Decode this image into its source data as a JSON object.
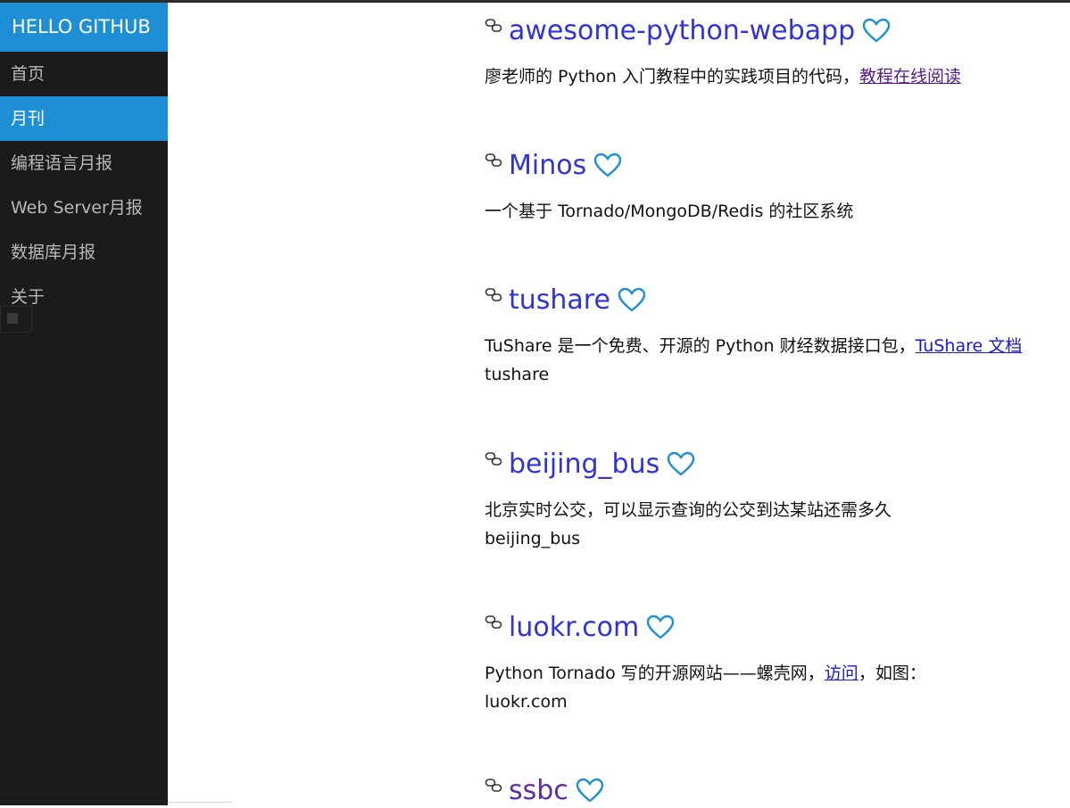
{
  "sidebar": {
    "brand": "HELLO GITHUB",
    "items": [
      {
        "label": "首页",
        "active": false
      },
      {
        "label": "月刊",
        "active": true
      },
      {
        "label": "编程语言月报",
        "active": false
      },
      {
        "label": "Web Server月报",
        "active": false
      },
      {
        "label": "数据库月报",
        "active": false
      },
      {
        "label": "关于",
        "active": false
      }
    ]
  },
  "projects": [
    {
      "name": "awesome-python-webapp",
      "desc": "廖老师的 Python 入门教程中的实践项目的代码，",
      "link": "教程在线阅读",
      "extra": ""
    },
    {
      "name": "Minos",
      "desc": "一个基于 Tornado/MongoDB/Redis 的社区系统",
      "link": "",
      "extra": ""
    },
    {
      "name": "tushare",
      "desc": "TuShare 是一个免费、开源的 Python 财经数据接口包，",
      "link": "TuShare 文档",
      "extra": "tushare"
    },
    {
      "name": "beijing_bus",
      "desc": "北京实时公交，可以显示查询的公交到达某站还需多久",
      "link": "",
      "extra": "beijing_bus"
    },
    {
      "name": "luokr.com",
      "desc": "Python Tornado 写的开源网站——螺壳网，",
      "link": "访问",
      "desc_after": "，如图：",
      "extra": "luokr.com"
    },
    {
      "name": "ssbc",
      "desc": "",
      "link": "",
      "extra": ""
    }
  ],
  "colors": {
    "accent": "#1e8fd5",
    "sidebar_bg": "#1b1b1b",
    "title_link": "#2f33d8",
    "heart": "#1e8fd5"
  },
  "icons": {
    "title_prefix": "link-icon",
    "title_suffix": "heart-icon"
  }
}
